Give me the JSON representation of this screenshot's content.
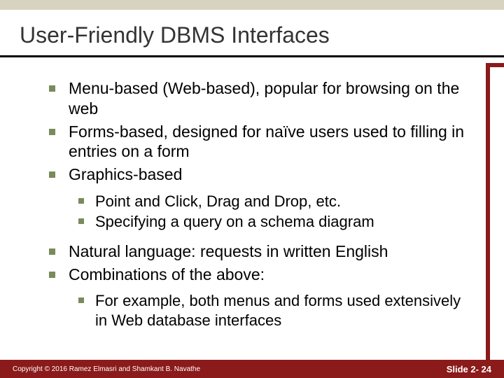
{
  "title": "User-Friendly DBMS Interfaces",
  "bullets": {
    "b0": "Menu-based (Web-based), popular for browsing on the web",
    "b1": "Forms-based, designed for naïve users used to filling in entries on a form",
    "b2": "Graphics-based",
    "b2s0": "Point and Click, Drag and Drop, etc.",
    "b2s1": "Specifying a query on a schema diagram",
    "b3": "Natural language: requests in written English",
    "b4": "Combinations of the above:",
    "b4s0": "For example, both menus and forms used extensively in Web database interfaces"
  },
  "footer": {
    "copyright": "Copyright © 2016 Ramez Elmasri and Shamkant B. Navathe",
    "slide": "Slide 2- 24"
  }
}
